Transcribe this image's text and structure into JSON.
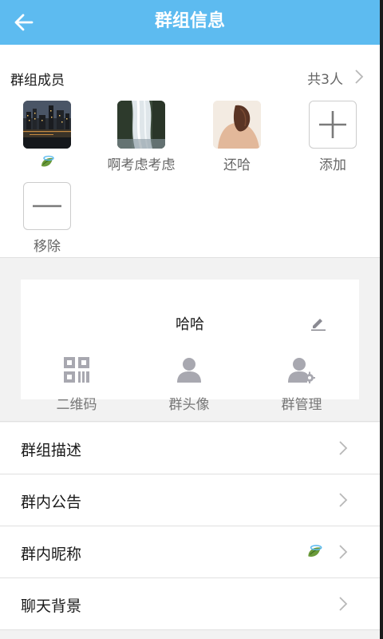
{
  "header": {
    "title": "群组信息",
    "back_icon": "back-arrow-icon"
  },
  "members": {
    "title": "群组成员",
    "count_label": "共3人",
    "items": [
      {
        "name": "",
        "avatar": "city-night-avatar",
        "badge_icon": "leaf-water-icon"
      },
      {
        "name": "啊考虑考虑",
        "avatar": "waterfall-avatar"
      },
      {
        "name": "还哈",
        "avatar": "person-back-avatar"
      }
    ],
    "add_label": "添加",
    "remove_label": "移除"
  },
  "group_card": {
    "name": "哈哈",
    "edit_icon": "pencil-icon",
    "actions": [
      {
        "label": "二维码",
        "icon": "qrcode-icon"
      },
      {
        "label": "群头像",
        "icon": "person-icon"
      },
      {
        "label": "群管理",
        "icon": "person-gear-icon"
      }
    ]
  },
  "menu": {
    "items": [
      {
        "label": "群组描述"
      },
      {
        "label": "群内公告"
      },
      {
        "label": "群内昵称",
        "value_icon": "leaf-water-icon"
      },
      {
        "label": "聊天背景"
      }
    ]
  },
  "colors": {
    "accent": "#5dbbf0",
    "icon_gray": "#a8a8b0",
    "text_secondary": "#777777"
  }
}
